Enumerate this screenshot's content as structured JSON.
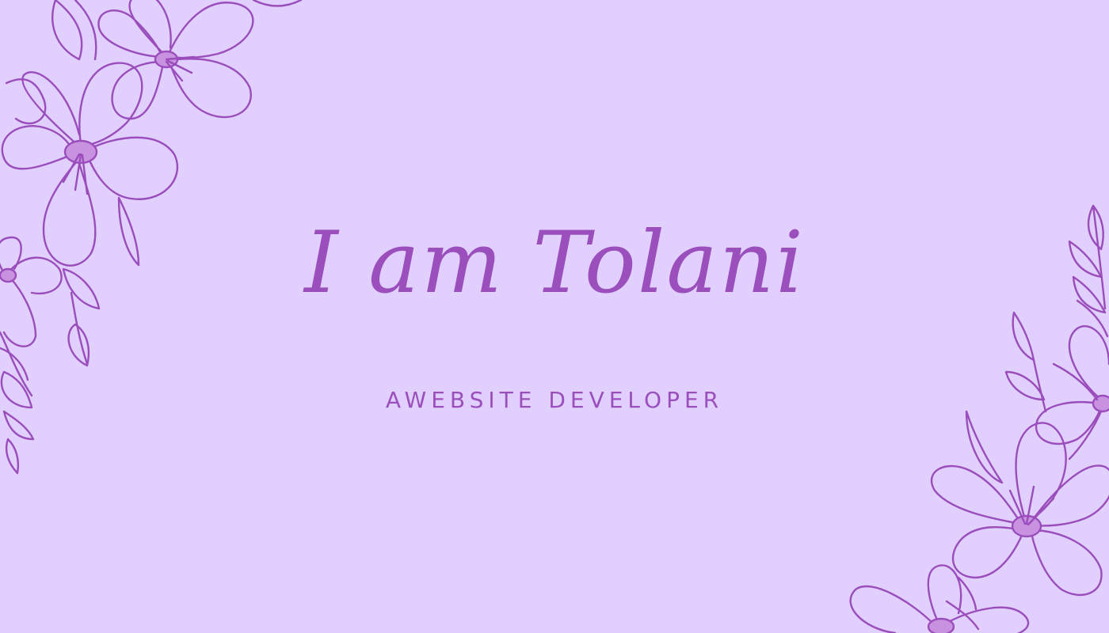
{
  "page": {
    "background_color": "#e1d0fe",
    "accent_color": "#9b4fbd"
  },
  "hero": {
    "title": "I am Tolani",
    "subtitle": "AWEBSITE DEVELOPER"
  },
  "decorations": {
    "top_left": "floral-line-art",
    "bottom_right": "floral-line-art"
  }
}
